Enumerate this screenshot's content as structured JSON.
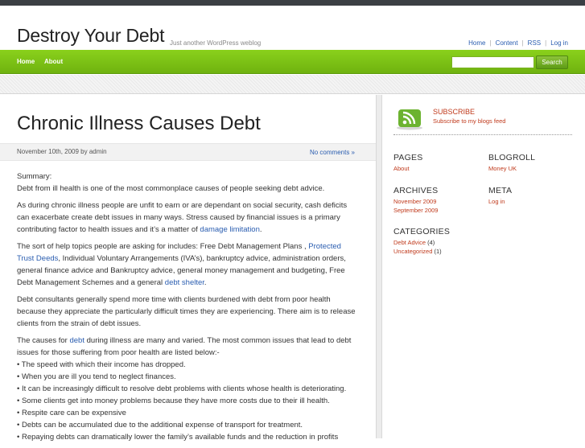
{
  "header": {
    "site_title": "Destroy Your Debt",
    "tagline": "Just another WordPress weblog",
    "links": [
      "Home",
      "Content",
      "RSS",
      "Log in"
    ]
  },
  "nav": {
    "items": [
      "Home",
      "About"
    ],
    "search_button": "Search",
    "search_placeholder": ""
  },
  "post": {
    "title": "Chronic Illness Causes Debt",
    "date": "November 10th, 2009 by admin",
    "comments": "No comments »",
    "p1a": "Summary:",
    "p1b": "Debt from ill health is one of the most commonplace causes of people seeking debt advice.",
    "p2": "As during chronic illness people are unfit to earn or are dependant on social security, cash deficits can exacerbate create debt issues in many ways. Stress caused by financial issues is a primary contributing factor to health issues and it’s a matter of",
    "p2_link": "damage limitation",
    "p2_end": ".",
    "p3a": "The sort of help topics people are asking for includes: Free Debt Management Plans ,",
    "p3_link1": "Protected Trust Deeds",
    "p3b": ", Individual Voluntary Arrangements (IVA’s), bankruptcy advice, administration orders, general finance advice and  Bankruptcy advice, general money management and budgeting, Free Debt Management Schemes and a general",
    "p3_link2": "debt shelter",
    "p3_end": ".",
    "p4": "Debt consultants generally spend more time with clients burdened with debt from poor health because they appreciate the particularly difficult times they are experiencing. There aim is to release clients from the strain of debt issues.",
    "p5a": "The causes for",
    "p5_link": "debt",
    "p5b": "during illness are many and varied. The most common issues that lead to debt issues for those suffering from poor health are listed below:-",
    "bullets": [
      "• The speed with which their income has dropped.",
      "• When you are ill you tend to neglect finances.",
      "• It can be increasingly difficult to resolve debt problems with clients whose health is deteriorating.",
      "• Some clients get into money problems because they have more costs due to their ill health.",
      "• Respite care can be expensive",
      "• Debts can be accumulated due to the additional expense of transport for treatment.",
      "• Repaying debts can dramatically lower the family’s available funds and the reduction in profits"
    ]
  },
  "sidebar": {
    "subscribe_title": "SUBSCRIBE",
    "subscribe_text": "Subscribe to my blogs feed",
    "pages_title": "PAGES",
    "pages": [
      "About"
    ],
    "blogroll_title": "BLOGROLL",
    "blogroll": [
      "Money UK"
    ],
    "archives_title": "ARCHIVES",
    "archives": [
      "November 2009",
      "September 2009"
    ],
    "meta_title": "META",
    "meta": [
      "Log in"
    ],
    "categories_title": "CATEGORIES",
    "categories": [
      {
        "name": "Debt Advice",
        "count": "(4)"
      },
      {
        "name": "Uncategorized",
        "count": "(1)"
      }
    ]
  },
  "colors": {
    "nav_green": "#7cc215",
    "link_blue": "#2a5db0",
    "sidebar_red": "#c03a1c"
  }
}
